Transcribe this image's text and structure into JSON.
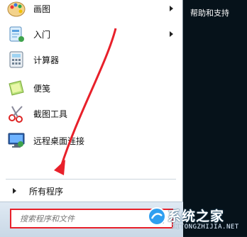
{
  "programs": [
    {
      "label": "画图",
      "icon": "paint-icon",
      "has_submenu": true
    },
    {
      "label": "入门",
      "icon": "getting-started-icon",
      "has_submenu": true
    },
    {
      "label": "计算器",
      "icon": "calculator-icon",
      "has_submenu": false
    },
    {
      "label": "便笺",
      "icon": "sticky-notes-icon",
      "has_submenu": false
    },
    {
      "label": "截图工具",
      "icon": "snipping-tool-icon",
      "has_submenu": false
    },
    {
      "label": "远程桌面连接",
      "icon": "remote-desktop-icon",
      "has_submenu": false
    }
  ],
  "all_programs": {
    "label": "所有程序"
  },
  "search": {
    "placeholder": "搜索程序和文件",
    "value": ""
  },
  "right_panel": {
    "help": "帮助和支持"
  },
  "watermark": {
    "text": "系统之家",
    "url": "XITONGZHIJIA.NET"
  },
  "colors": {
    "highlight_box": "#e8202a",
    "arrow": "#e8202a",
    "right_panel": "#06121a"
  }
}
